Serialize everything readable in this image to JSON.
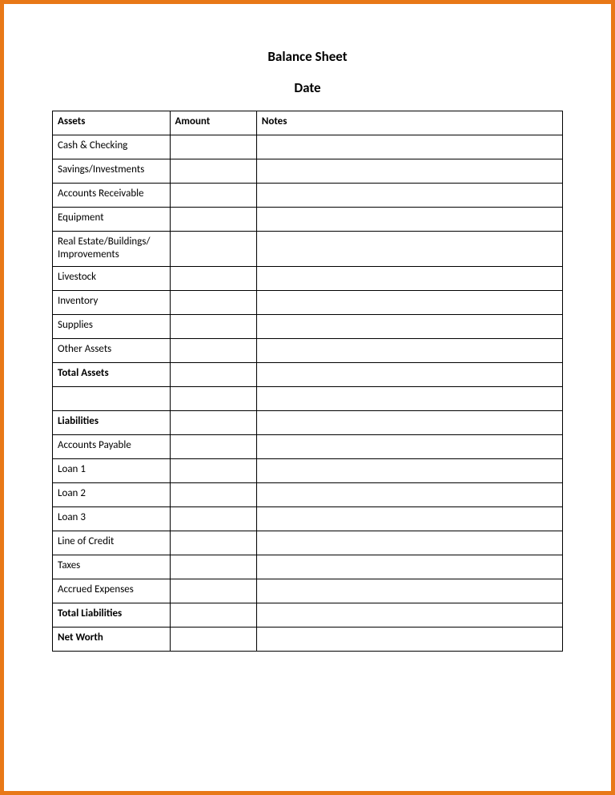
{
  "title": "Balance Sheet",
  "subtitle": "Date",
  "headers": {
    "col1": "Assets",
    "col2": "Amount",
    "col3": "Notes"
  },
  "rows": [
    {
      "label": "Cash & Checking",
      "amount": "",
      "notes": "",
      "bold": false
    },
    {
      "label": "Savings/Investments",
      "amount": "",
      "notes": "",
      "bold": false
    },
    {
      "label": "Accounts Receivable",
      "amount": "",
      "notes": "",
      "bold": false
    },
    {
      "label": "Equipment",
      "amount": "",
      "notes": "",
      "bold": false
    },
    {
      "label": "Real Estate/Buildings/\nImprovements",
      "amount": "",
      "notes": "",
      "bold": false,
      "tall": true
    },
    {
      "label": "Livestock",
      "amount": "",
      "notes": "",
      "bold": false
    },
    {
      "label": "Inventory",
      "amount": "",
      "notes": "",
      "bold": false
    },
    {
      "label": "Supplies",
      "amount": "",
      "notes": "",
      "bold": false
    },
    {
      "label": "Other Assets",
      "amount": "",
      "notes": "",
      "bold": false
    },
    {
      "label": "Total Assets",
      "amount": "",
      "notes": "",
      "bold": true
    },
    {
      "label": "",
      "amount": "",
      "notes": "",
      "bold": false,
      "spacer": true
    },
    {
      "label": "Liabilities",
      "amount": "",
      "notes": "",
      "bold": true
    },
    {
      "label": "Accounts Payable",
      "amount": "",
      "notes": "",
      "bold": false
    },
    {
      "label": "Loan 1",
      "amount": "",
      "notes": "",
      "bold": false
    },
    {
      "label": "Loan 2",
      "amount": "",
      "notes": "",
      "bold": false
    },
    {
      "label": "Loan 3",
      "amount": "",
      "notes": "",
      "bold": false
    },
    {
      "label": "Line of Credit",
      "amount": "",
      "notes": "",
      "bold": false
    },
    {
      "label": "Taxes",
      "amount": "",
      "notes": "",
      "bold": false
    },
    {
      "label": "Accrued Expenses",
      "amount": "",
      "notes": "",
      "bold": false
    },
    {
      "label": "Total Liabilities",
      "amount": "",
      "notes": "",
      "bold": true
    },
    {
      "label": "Net Worth",
      "amount": "",
      "notes": "",
      "bold": true
    }
  ]
}
